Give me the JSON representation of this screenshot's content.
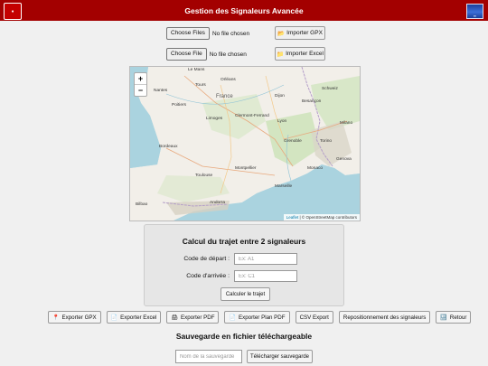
{
  "header": {
    "title": "Gestion des Signaleurs Avancée"
  },
  "gpx_upload": {
    "button_label": "Choose Files",
    "status": "No file chosen",
    "import_label": "Importer GPX"
  },
  "excel_upload": {
    "button_label": "Choose File",
    "status": "No file chosen",
    "import_label": "Importer Excel"
  },
  "map": {
    "zoom_in": "+",
    "zoom_out": "−",
    "attribution_leaflet": "Leaflet",
    "attribution_rest": " | © OpenStreetMap contributors",
    "cities": {
      "le_mans": "Le Mans",
      "paris_region": "Orléans",
      "france": "France",
      "tours": "Tours",
      "poitiers": "Poitiers",
      "limoges": "Limoges",
      "clermont": "Clermont-Ferrand",
      "lyon": "Lyon",
      "grenoble": "Grenoble",
      "bordeaux": "Bordeaux",
      "toulouse": "Toulouse",
      "montpellier": "Montpellier",
      "marseille": "Marseille",
      "nice": "Monaco",
      "bern": "Schweiz",
      "torino": "Torino",
      "milano": "Milano",
      "genova": "Genova",
      "andorra": "Andorra",
      "besancon": "Besançon",
      "dijon": "Dijon",
      "nantes": "Nantes",
      "bilbao": "Bilbao"
    }
  },
  "route": {
    "title": "Calcul du trajet entre 2 signaleurs",
    "start_label": "Code de départ :",
    "start_placeholder": "Ex: A1",
    "end_label": "Code d'arrivée :",
    "end_placeholder": "Ex: C1",
    "calc_label": "Calculer le trajet"
  },
  "toolbar": {
    "export_gpx": "Exporter GPX",
    "export_excel": "Exporter Excel",
    "export_pdf": "Exporter PDF",
    "export_plan_pdf": "Exporter Plan PDF",
    "csv_export": "CSV Export",
    "reposition": "Repositionnement des signaleurs",
    "back": "Retour"
  },
  "save": {
    "title": "Sauvegarde en fichier téléchargeable",
    "name_placeholder": "Nom de la sauvegarde",
    "download_label": "Télécharger sauvegarde"
  }
}
